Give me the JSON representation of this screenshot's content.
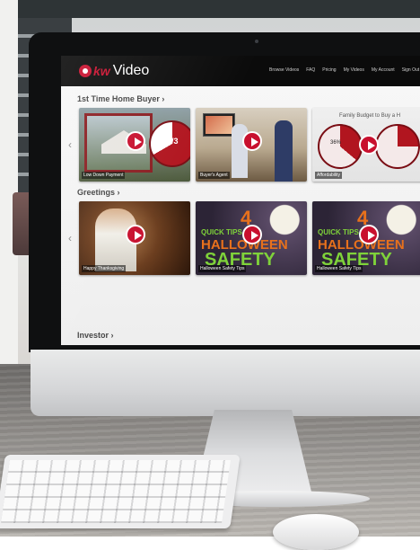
{
  "site": {
    "brand_kw": "kw",
    "brand_video": "Video",
    "nav": [
      "Browse Videos",
      "FAQ",
      "Pricing",
      "My Videos",
      "My Account",
      "Sign Out"
    ]
  },
  "sections": [
    {
      "title": "1st Time Home Buyer ›",
      "cards": [
        {
          "caption": "Low Down Payment",
          "overlay": "2/3"
        },
        {
          "caption": "Buyer's Agent"
        },
        {
          "caption": "Affordability",
          "overlay": "Family Budget to Buy a H",
          "overlay_pct": "36%"
        }
      ]
    },
    {
      "title": "Greetings ›",
      "cards": [
        {
          "caption": "Happy Thanksgiving"
        },
        {
          "caption": "Halloween Safety Tips",
          "num": "4",
          "quick": "QUICK TIPS FOR",
          "hw": "HALLOWEEN",
          "safety": "SAFETY"
        },
        {
          "caption": "Halloween Safety Tips",
          "num": "4",
          "quick": "QUICK TIPS FOR",
          "hw": "HALLOWEEN",
          "safety": "SAFETY"
        }
      ]
    },
    {
      "title": "Investor ›"
    }
  ],
  "colors": {
    "brand_red": "#c8102e",
    "topbar": "#0b0b0b",
    "content_bg": "#f3f3f3"
  }
}
